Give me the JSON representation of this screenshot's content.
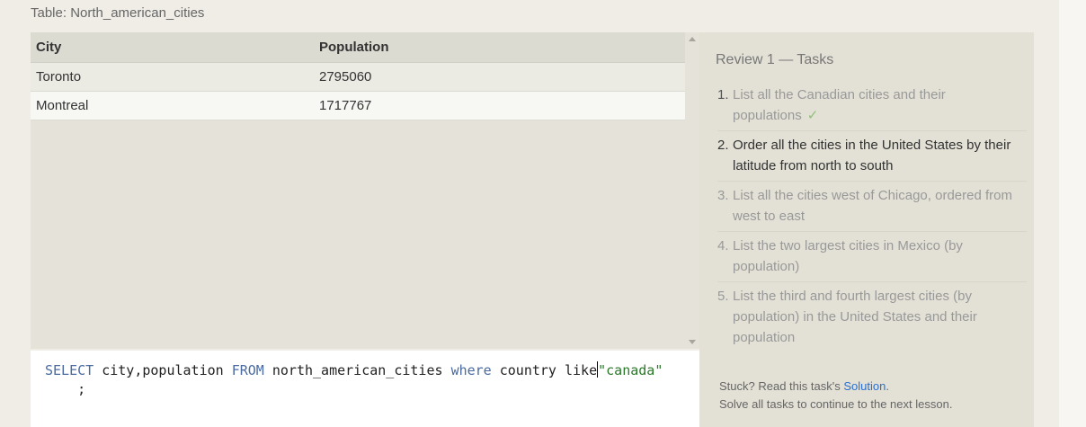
{
  "table_caption": "Table: North_american_cities",
  "results": {
    "columns": [
      "City",
      "Population"
    ],
    "rows": [
      [
        "Toronto",
        "2795060"
      ],
      [
        "Montreal",
        "1717767"
      ]
    ]
  },
  "editor": {
    "kw_select": "SELECT",
    "cols": " city,population ",
    "kw_from": "FROM",
    "table": " north_american_cities ",
    "kw_where": "where",
    "cond": " country like",
    "str_value": "\"canada\"",
    "line2": "    ;"
  },
  "tasks": {
    "heading": "Review 1 — Tasks",
    "items": [
      {
        "num": "1.",
        "text": "List all the Canadian cities and their populations",
        "check": "✓"
      },
      {
        "num": "2.",
        "text": "Order all the cities in the United States by their latitude from north to south"
      },
      {
        "num": "3.",
        "text": "List all the cities west of Chicago, ordered from west to east"
      },
      {
        "num": "4.",
        "text": "List the two largest cities in Mexico (by population)"
      },
      {
        "num": "5.",
        "text": "List the third and fourth largest cities (by population) in the United States and their population"
      }
    ],
    "stuck_prefix": "Stuck? Read this task's ",
    "solution_link": "Solution",
    "stuck_suffix": ".",
    "continue_note": "Solve all tasks to continue to the next lesson."
  },
  "colors": {
    "keyword": "#4a6aa0",
    "string": "#2b7a2b",
    "link": "#2a6fcf",
    "check": "#8fbf7a"
  }
}
